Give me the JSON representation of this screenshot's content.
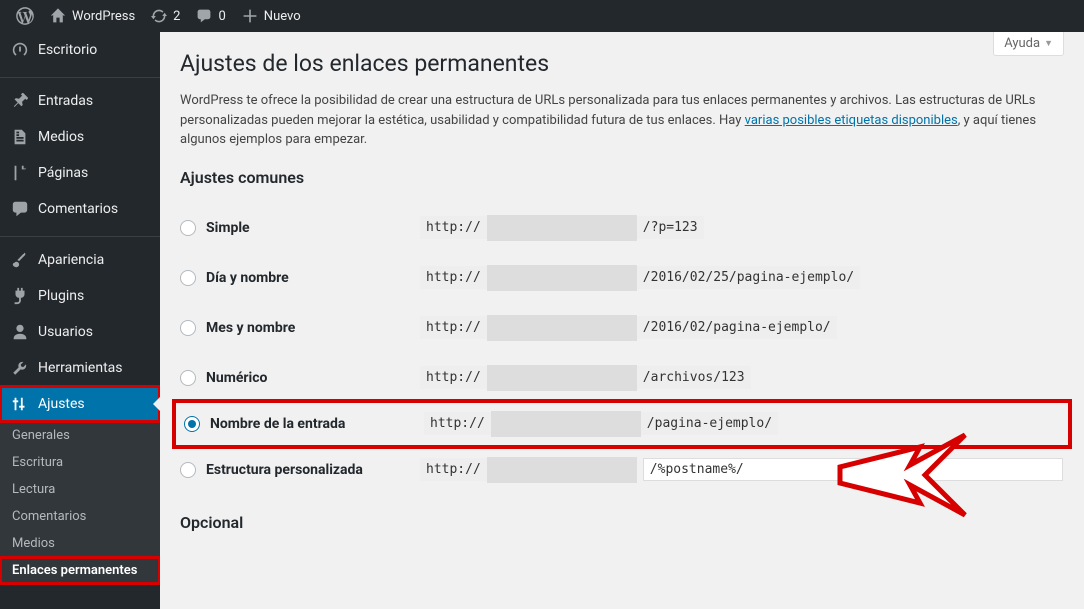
{
  "adminbar": {
    "site_name": "WordPress",
    "updates_count": "2",
    "comments_count": "0",
    "new_label": "Nuevo"
  },
  "sidebar": {
    "items": [
      {
        "id": "dashboard",
        "label": "Escritorio",
        "icon": "dashboard"
      },
      {
        "sep": true
      },
      {
        "id": "posts",
        "label": "Entradas",
        "icon": "pin"
      },
      {
        "id": "media",
        "label": "Medios",
        "icon": "media"
      },
      {
        "id": "pages",
        "label": "Páginas",
        "icon": "page"
      },
      {
        "id": "comments",
        "label": "Comentarios",
        "icon": "comment"
      },
      {
        "sep": true
      },
      {
        "id": "appearance",
        "label": "Apariencia",
        "icon": "brush"
      },
      {
        "id": "plugins",
        "label": "Plugins",
        "icon": "plug"
      },
      {
        "id": "users",
        "label": "Usuarios",
        "icon": "user"
      },
      {
        "id": "tools",
        "label": "Herramientas",
        "icon": "wrench"
      },
      {
        "id": "settings",
        "label": "Ajustes",
        "icon": "sliders",
        "current": true,
        "highlight": true,
        "submenu": [
          {
            "id": "general",
            "label": "Generales"
          },
          {
            "id": "writing",
            "label": "Escritura"
          },
          {
            "id": "reading",
            "label": "Lectura"
          },
          {
            "id": "discussion",
            "label": "Comentarios"
          },
          {
            "id": "media",
            "label": "Medios"
          },
          {
            "id": "permalinks",
            "label": "Enlaces permanentes",
            "current": true,
            "highlight": true
          }
        ]
      }
    ]
  },
  "page": {
    "help_label": "Ayuda",
    "title": "Ajustes de los enlaces permanentes",
    "intro_pre": "WordPress te ofrece la posibilidad de crear una estructura de URLs personalizada para tus enlaces permanentes y archivos. Las estructuras de URLs personalizadas pueden mejorar la estética, usabilidad y compatibilidad futura de tus enlaces. Hay ",
    "intro_link": "varias posibles etiquetas disponibles",
    "intro_post": ", y aquí tienes algunos ejemplos para empezar.",
    "common_heading": "Ajustes comunes",
    "optional_heading": "Opcional",
    "url_prefix": "http://",
    "options": [
      {
        "id": "plain",
        "label": "Simple",
        "example": "/?p=123"
      },
      {
        "id": "dayname",
        "label": "Día y nombre",
        "example": "/2016/02/25/pagina-ejemplo/"
      },
      {
        "id": "monthname",
        "label": "Mes y nombre",
        "example": "/2016/02/pagina-ejemplo/"
      },
      {
        "id": "numeric",
        "label": "Numérico",
        "example": "/archivos/123"
      },
      {
        "id": "postname",
        "label": "Nombre de la entrada",
        "example": "/pagina-ejemplo/",
        "selected": true,
        "highlight": true
      },
      {
        "id": "custom",
        "label": "Estructura personalizada",
        "custom_value": "/%postname%/"
      }
    ]
  }
}
